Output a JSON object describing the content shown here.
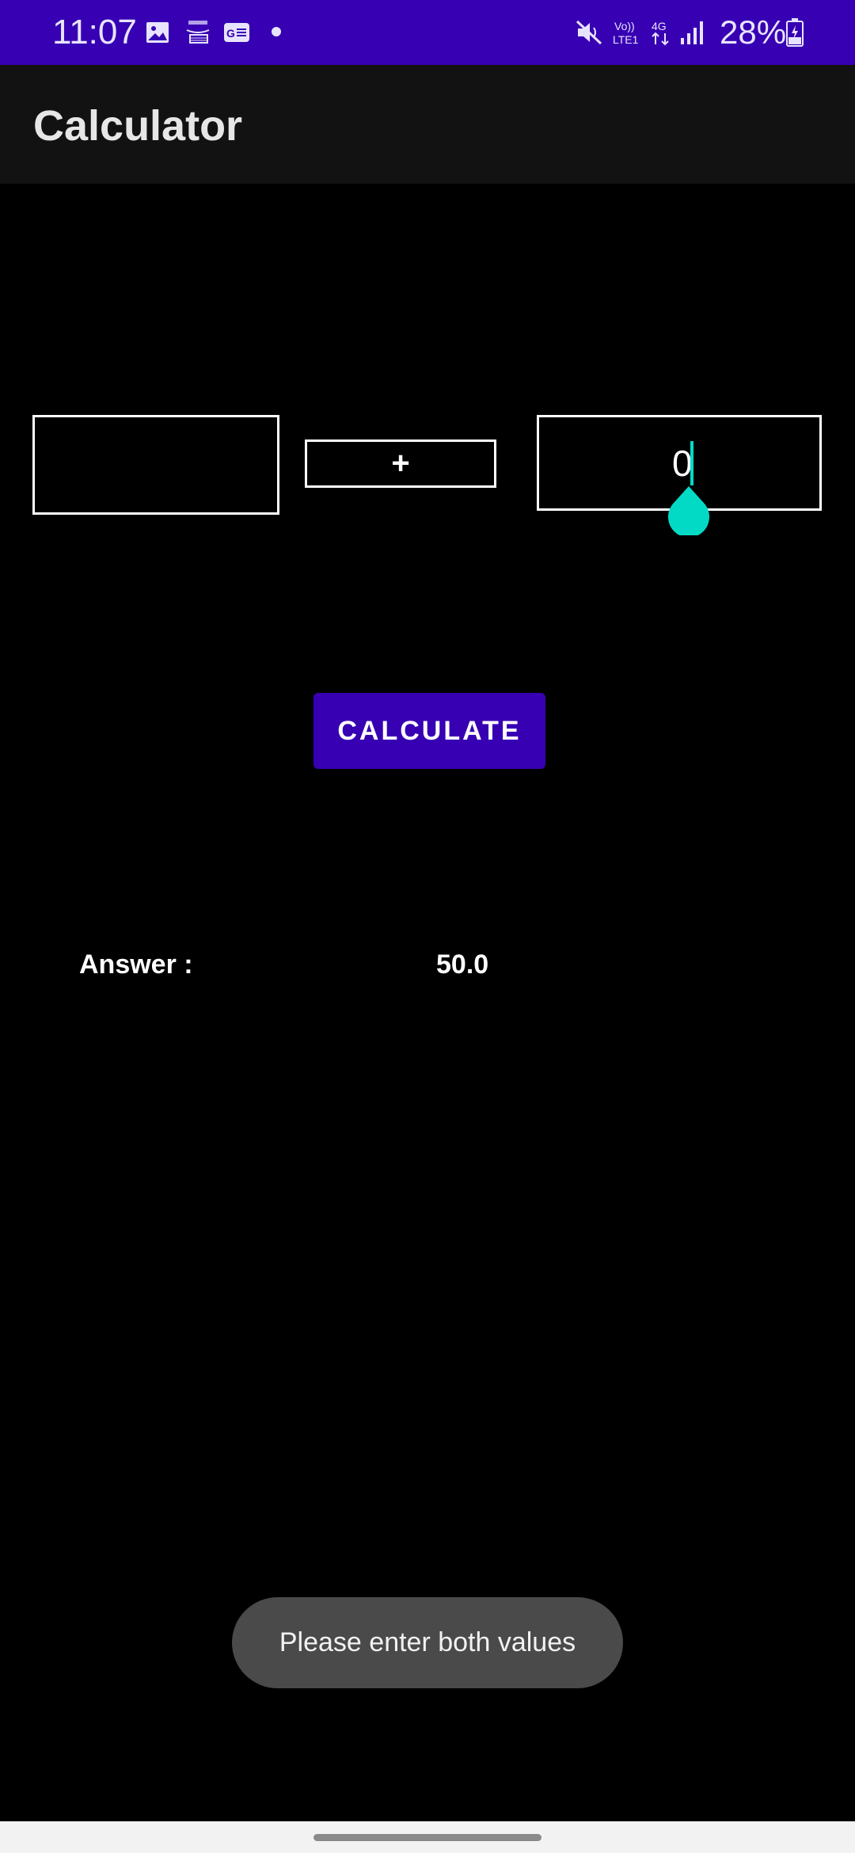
{
  "status_bar": {
    "time": "11:07",
    "battery": "28%",
    "icons": [
      "image-icon",
      "amazon-icon",
      "news-icon",
      "notification-dot",
      "mute-icon",
      "volte-icon",
      "4g-icon",
      "signal-icon",
      "battery-icon"
    ],
    "background": "#3700B3"
  },
  "app_bar": {
    "title": "Calculator"
  },
  "inputs": {
    "first_value": "",
    "operator": "+",
    "second_value": "0"
  },
  "calculate_button": {
    "label": "CALCULATE",
    "color": "#3700B3"
  },
  "answer": {
    "label": "Answer :",
    "value": "50.0"
  },
  "toast": {
    "message": "Please enter both values"
  },
  "accent_color": "#03DAC5"
}
